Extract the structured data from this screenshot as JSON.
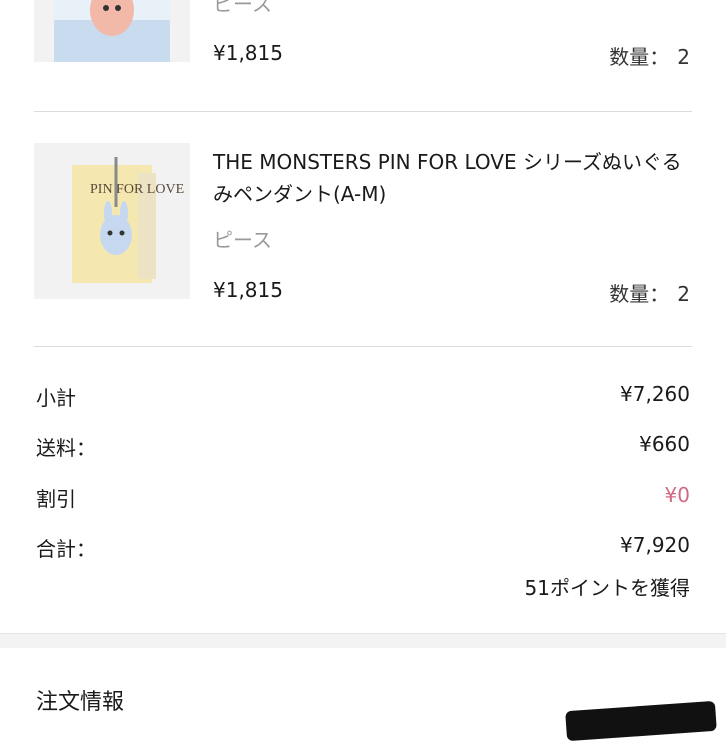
{
  "order_items": [
    {
      "name": "",
      "unit": "ピース",
      "price": "¥1,815",
      "quantity_label": "数量：",
      "quantity": "2"
    },
    {
      "name": "THE MONSTERS PIN FOR LOVE シリーズぬいぐるみペンダント(A-M)",
      "unit": "ピース",
      "price": "¥1,815",
      "quantity_label": "数量：",
      "quantity": "2",
      "package_text": "PIN FOR LOVE"
    }
  ],
  "summary": {
    "subtotal_label": "小計",
    "subtotal_value": "¥7,260",
    "shipping_label": "送料：",
    "shipping_value": "¥660",
    "discount_label": "割引",
    "discount_value": "¥0",
    "total_label": "合計：",
    "total_value": "¥7,920",
    "points_text": "51ポイントを獲得"
  },
  "order_info": {
    "title": "注文情報"
  },
  "colors": {
    "discount": "#d06a83",
    "package_yellow": "#f5e7b0"
  }
}
